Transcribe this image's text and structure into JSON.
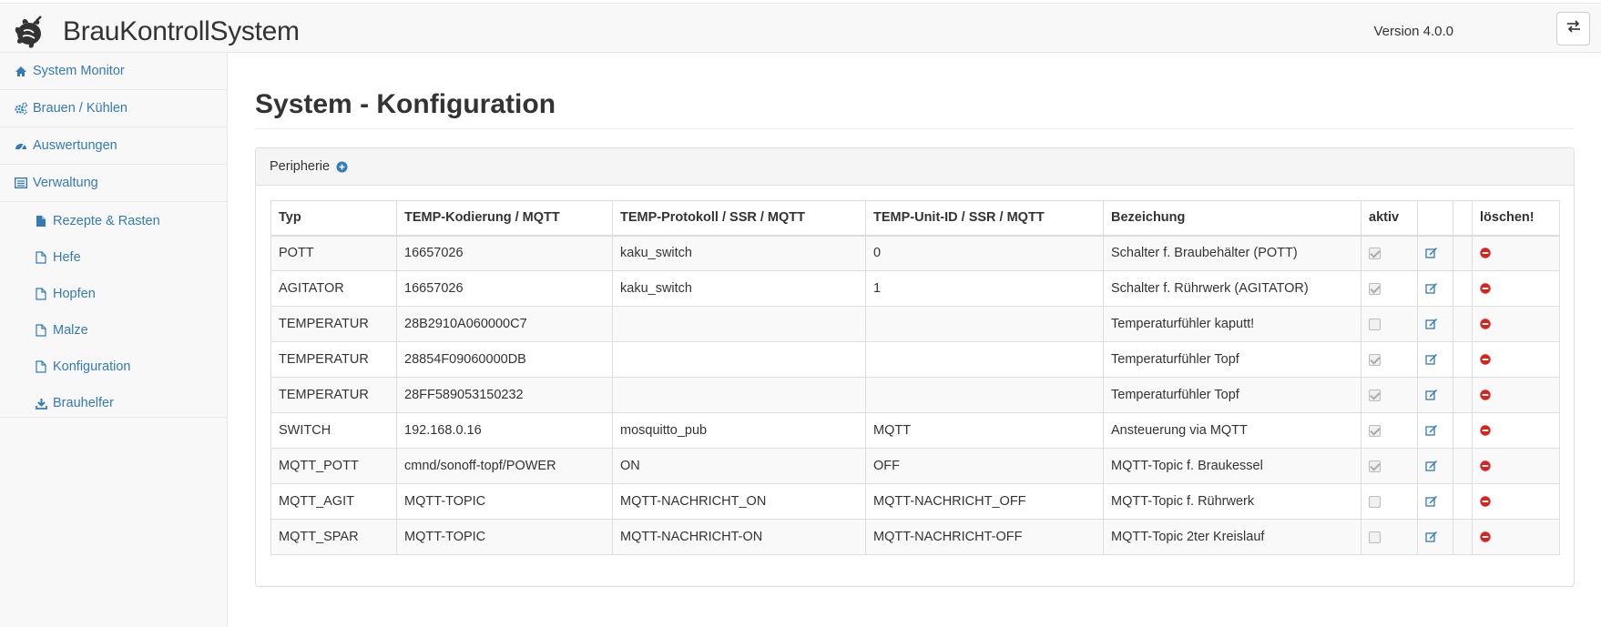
{
  "app": {
    "title": "BrauKontrollSystem",
    "version": "Version 4.0.0",
    "toggle_icon": "exchange-icon"
  },
  "sidebar": {
    "items": [
      {
        "label": "System Monitor",
        "icon": "home-icon"
      },
      {
        "label": "Brauen / Kühlen",
        "icon": "gears-icon"
      },
      {
        "label": "Auswertungen",
        "icon": "dashboard-icon"
      },
      {
        "label": "Verwaltung",
        "icon": "list-icon"
      }
    ],
    "subitems": [
      {
        "label": "Rezepte & Rasten",
        "icon": "file-filled-icon"
      },
      {
        "label": "Hefe",
        "icon": "file-outline-icon"
      },
      {
        "label": "Hopfen",
        "icon": "file-outline-icon"
      },
      {
        "label": "Malze",
        "icon": "file-outline-icon"
      },
      {
        "label": "Konfiguration",
        "icon": "file-outline-icon"
      },
      {
        "label": "Brauhelfer",
        "icon": "download-icon"
      }
    ]
  },
  "main": {
    "title": "System - Konfiguration",
    "panel_title": "Peripherie",
    "table": {
      "headers": [
        "Typ",
        "TEMP-Kodierung / MQTT",
        "TEMP-Protokoll / SSR / MQTT",
        "TEMP-Unit-ID / SSR / MQTT",
        "Bezeichung",
        "aktiv",
        "",
        "",
        "löschen!"
      ],
      "rows": [
        {
          "typ": "POTT",
          "kodierung": "16657026",
          "protokoll": "kaku_switch",
          "unit": "0",
          "bezeichnung": "Schalter f. Braubehälter (POTT)",
          "aktiv": true
        },
        {
          "typ": "AGITATOR",
          "kodierung": "16657026",
          "protokoll": "kaku_switch",
          "unit": "1",
          "bezeichnung": "Schalter f. Rührwerk (AGITATOR)",
          "aktiv": true
        },
        {
          "typ": "TEMPERATUR",
          "kodierung": "28B2910A060000C7",
          "protokoll": "",
          "unit": "",
          "bezeichnung": "Temperaturfühler kaputt!",
          "aktiv": false
        },
        {
          "typ": "TEMPERATUR",
          "kodierung": "28854F09060000DB",
          "protokoll": "",
          "unit": "",
          "bezeichnung": "Temperaturfühler Topf",
          "aktiv": true
        },
        {
          "typ": "TEMPERATUR",
          "kodierung": "28FF589053150232",
          "protokoll": "",
          "unit": "",
          "bezeichnung": "Temperaturfühler Topf",
          "aktiv": true
        },
        {
          "typ": "SWITCH",
          "kodierung": "192.168.0.16",
          "protokoll": "mosquitto_pub",
          "unit": "MQTT",
          "bezeichnung": "Ansteuerung via MQTT",
          "aktiv": true
        },
        {
          "typ": "MQTT_POTT",
          "kodierung": "cmnd/sonoff-topf/POWER",
          "protokoll": "ON",
          "unit": "OFF",
          "bezeichnung": "MQTT-Topic f. Braukessel",
          "aktiv": true
        },
        {
          "typ": "MQTT_AGIT",
          "kodierung": "MQTT-TOPIC",
          "protokoll": "MQTT-NACHRICHT_ON",
          "unit": "MQTT-NACHRICHT_OFF",
          "bezeichnung": "MQTT-Topic f. Rührwerk",
          "aktiv": false
        },
        {
          "typ": "MQTT_SPAR",
          "kodierung": "MQTT-TOPIC",
          "protokoll": "MQTT-NACHRICHT-ON",
          "unit": "MQTT-NACHRICHT-OFF",
          "bezeichnung": "MQTT-Topic 2ter Kreislauf",
          "aktiv": false
        }
      ]
    }
  },
  "colors": {
    "link": "#337ab7",
    "delete": "#d9231c",
    "sidebar_bg": "#f8f8f8",
    "border": "#dddddd"
  }
}
